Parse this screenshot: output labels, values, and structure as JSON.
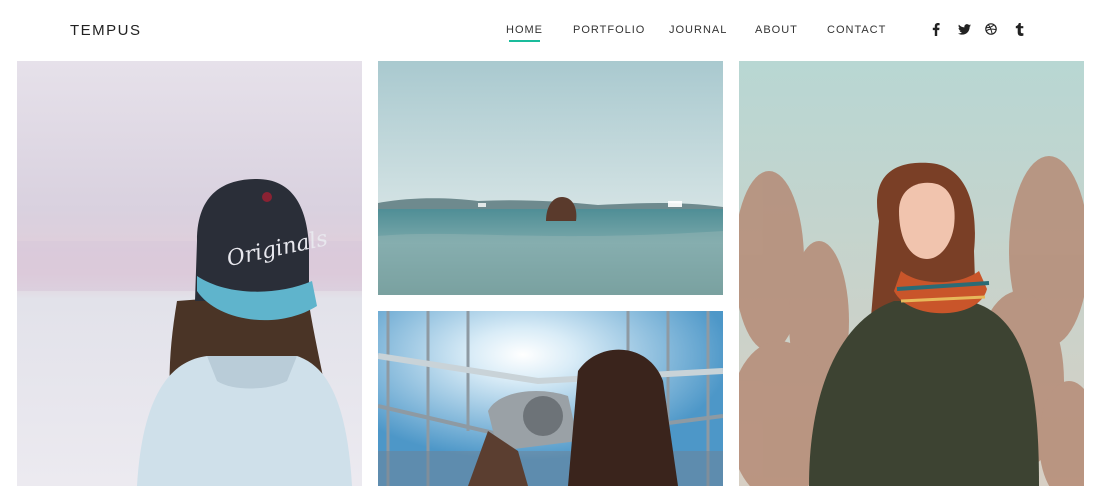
{
  "brand": {
    "name": "TEMPUS"
  },
  "nav": {
    "items": [
      {
        "label": "HOME",
        "active": true
      },
      {
        "label": "PORTFOLIO",
        "active": false
      },
      {
        "label": "JOURNAL",
        "active": false
      },
      {
        "label": "ABOUT",
        "active": false
      },
      {
        "label": "CONTACT",
        "active": false
      }
    ],
    "accent_color": "#1abc9c"
  },
  "social": [
    {
      "icon": "facebook-icon"
    },
    {
      "icon": "twitter-icon"
    },
    {
      "icon": "dribbble-icon"
    },
    {
      "icon": "tumblr-icon"
    }
  ],
  "gallery": {
    "photos": [
      {
        "subject": "girl-in-cap-photo",
        "cap_text": "Originals"
      },
      {
        "subject": "swimmer-in-sea-photo"
      },
      {
        "subject": "binoculars-viewer-photo"
      },
      {
        "subject": "woman-in-grass-photo"
      }
    ]
  }
}
